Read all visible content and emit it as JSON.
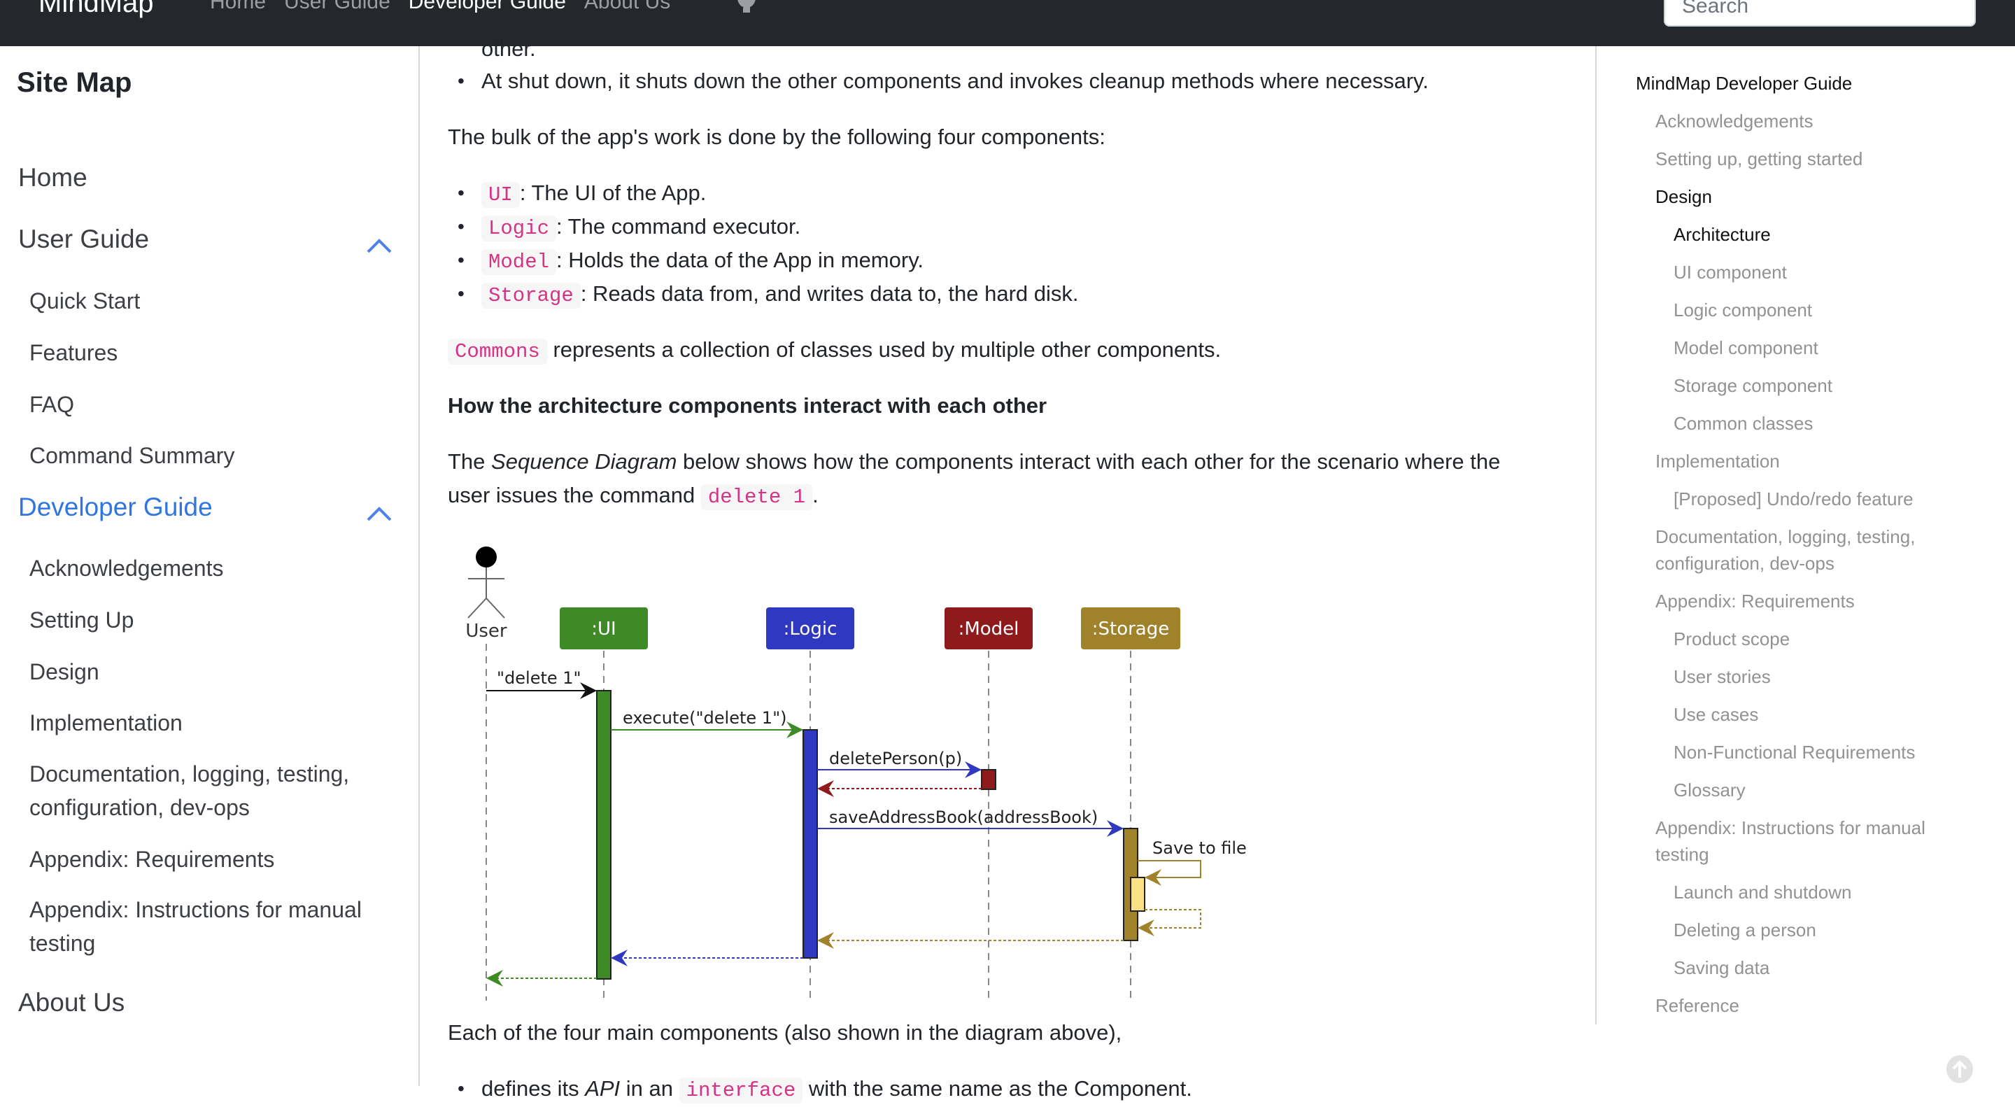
{
  "navbar": {
    "brand": "MindMap",
    "links": [
      "Home",
      "User Guide",
      "Developer Guide",
      "About Us"
    ],
    "active_link": "Developer Guide",
    "github_icon": "github-icon",
    "search_placeholder": "Search"
  },
  "sidebar": {
    "title": "Site Map",
    "items": [
      {
        "label": "Home"
      },
      {
        "label": "User Guide",
        "expanded": true,
        "children": [
          "Quick Start",
          "Features",
          "FAQ",
          "Command Summary"
        ]
      },
      {
        "label": "Developer Guide",
        "expanded": true,
        "active": true,
        "children": [
          "Acknowledgements",
          "Setting Up",
          "Design",
          "Implementation",
          "Documentation, logging, testing, configuration, dev-ops",
          "Appendix: Requirements",
          "Appendix: Instructions for manual testing"
        ]
      },
      {
        "label": "About Us"
      }
    ],
    "accent_color": "#2f76e1"
  },
  "main": {
    "clipped_line": "other.",
    "bullet_shutdown": "At shut down, it shuts down the other components and invokes cleanup methods where necessary.",
    "bulk_intro": "The bulk of the app's work is done by the following four components:",
    "components": [
      {
        "code": "UI",
        "text": ": The UI of the App."
      },
      {
        "code": "Logic",
        "text": ": The command executor."
      },
      {
        "code": "Model",
        "text": ": Holds the data of the App in memory."
      },
      {
        "code": "Storage",
        "text": ": Reads data from, and writes data to, the hard disk."
      }
    ],
    "commons_code": "Commons",
    "commons_text": "represents a collection of classes used by multiple other components.",
    "interact_heading": "How the architecture components interact with each other",
    "seq_intro_1": "The ",
    "seq_intro_em": "Sequence Diagram",
    "seq_intro_2": " below shows how the components interact with each other for the scenario where the",
    "seq_intro_3": "user issues the command ",
    "seq_intro_code": "delete 1",
    "seq_intro_4": ".",
    "each_of": "Each of the four main components (also shown in the diagram above),",
    "defines_1": "defines its ",
    "defines_em": "API",
    "defines_2": " in an ",
    "defines_code": "interface",
    "defines_3": " with the same name as the Component."
  },
  "diagram": {
    "actor": "User",
    "participants": [
      {
        "name": ":UI",
        "color": "#3d8a26"
      },
      {
        "name": ":Logic",
        "color": "#2f38c0"
      },
      {
        "name": ":Model",
        "color": "#8f1a1c"
      },
      {
        "name": ":Storage",
        "color": "#a0822a"
      }
    ],
    "messages": [
      {
        "from": "User",
        "to": ":UI",
        "label": "\"delete 1\"",
        "type": "call"
      },
      {
        "from": ":UI",
        "to": ":Logic",
        "label": "execute(\"delete 1\")",
        "type": "call"
      },
      {
        "from": ":Logic",
        "to": ":Model",
        "label": "deletePerson(p)",
        "type": "call"
      },
      {
        "from": ":Model",
        "to": ":Logic",
        "label": "",
        "type": "return"
      },
      {
        "from": ":Logic",
        "to": ":Storage",
        "label": "saveAddressBook(addressBook)",
        "type": "call"
      },
      {
        "from": ":Storage",
        "to": ":Storage",
        "label": "Save to file",
        "type": "self"
      },
      {
        "from": ":Storage",
        "to": ":Logic",
        "label": "",
        "type": "return"
      },
      {
        "from": ":Logic",
        "to": ":UI",
        "label": "",
        "type": "return"
      },
      {
        "from": ":UI",
        "to": "User",
        "label": "",
        "type": "return"
      }
    ],
    "self_activation_color": "#fbe186"
  },
  "toc": {
    "items": [
      {
        "label": "MindMap Developer Guide",
        "level": 0,
        "current": true
      },
      {
        "label": "Acknowledgements",
        "level": 1
      },
      {
        "label": "Setting up, getting started",
        "level": 1
      },
      {
        "label": "Design",
        "level": 1,
        "current": true
      },
      {
        "label": "Architecture",
        "level": 2,
        "current": true
      },
      {
        "label": "UI component",
        "level": 2
      },
      {
        "label": "Logic component",
        "level": 2
      },
      {
        "label": "Model component",
        "level": 2
      },
      {
        "label": "Storage component",
        "level": 2
      },
      {
        "label": "Common classes",
        "level": 2
      },
      {
        "label": "Implementation",
        "level": 1
      },
      {
        "label": "[Proposed] Undo/redo feature",
        "level": 2
      },
      {
        "label": "Documentation, logging, testing, configuration, dev-ops",
        "level": 1
      },
      {
        "label": "Appendix: Requirements",
        "level": 1
      },
      {
        "label": "Product scope",
        "level": 2
      },
      {
        "label": "User stories",
        "level": 2
      },
      {
        "label": "Use cases",
        "level": 2
      },
      {
        "label": "Non-Functional Requirements",
        "level": 2
      },
      {
        "label": "Glossary",
        "level": 2
      },
      {
        "label": "Appendix: Instructions for manual testing",
        "level": 1
      },
      {
        "label": "Launch and shutdown",
        "level": 2
      },
      {
        "label": "Deleting a person",
        "level": 2
      },
      {
        "label": "Saving data",
        "level": 2
      },
      {
        "label": "Reference",
        "level": 1
      }
    ]
  },
  "scroll_top_icon": "arrow-up-icon"
}
